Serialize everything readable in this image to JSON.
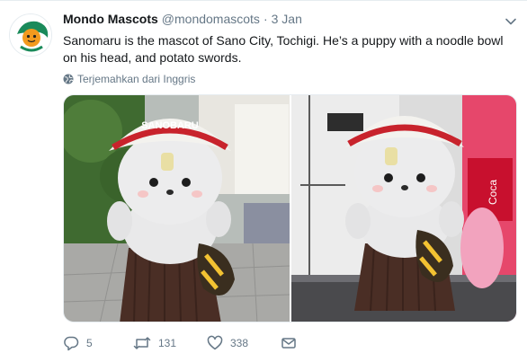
{
  "tweet": {
    "name": "Mondo Mascots",
    "handle": "@mondomascots",
    "separator": "·",
    "time": "3 Jan",
    "text": "Sanomaru is the mascot of Sano City, Tochigi. He’s a puppy with a noodle bowl on his head, and potato swords.",
    "translate_label": "Terjemahkan dari Inggris"
  },
  "actions": {
    "reply_count": "5",
    "retweet_count": "131",
    "like_count": "338"
  },
  "photos": {
    "bowl_text": "SANOBARU"
  },
  "colors": {
    "text": "#14171a",
    "secondary": "#657786",
    "border": "#e6ecf0",
    "avatar_green": "#1a8a5a"
  }
}
